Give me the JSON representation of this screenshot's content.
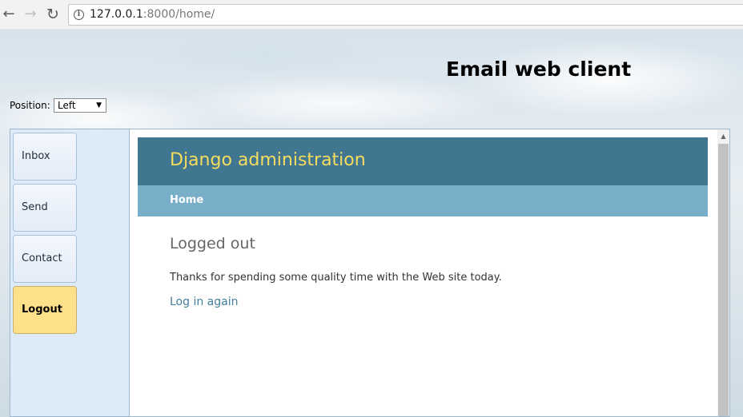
{
  "browser": {
    "url_host": "127.0.0.1",
    "url_rest": ":8000/home/"
  },
  "app": {
    "title": "Email web client",
    "position_label": "Position:",
    "position_value": "Left"
  },
  "sidebar": {
    "items": [
      {
        "label": "Inbox"
      },
      {
        "label": "Send"
      },
      {
        "label": "Contact"
      },
      {
        "label": "Logout"
      }
    ]
  },
  "django": {
    "site_title": "Django administration",
    "breadcrumb": "Home",
    "heading": "Logged out",
    "message": "Thanks for spending some quality time with the Web site today.",
    "login_link": "Log in again"
  }
}
